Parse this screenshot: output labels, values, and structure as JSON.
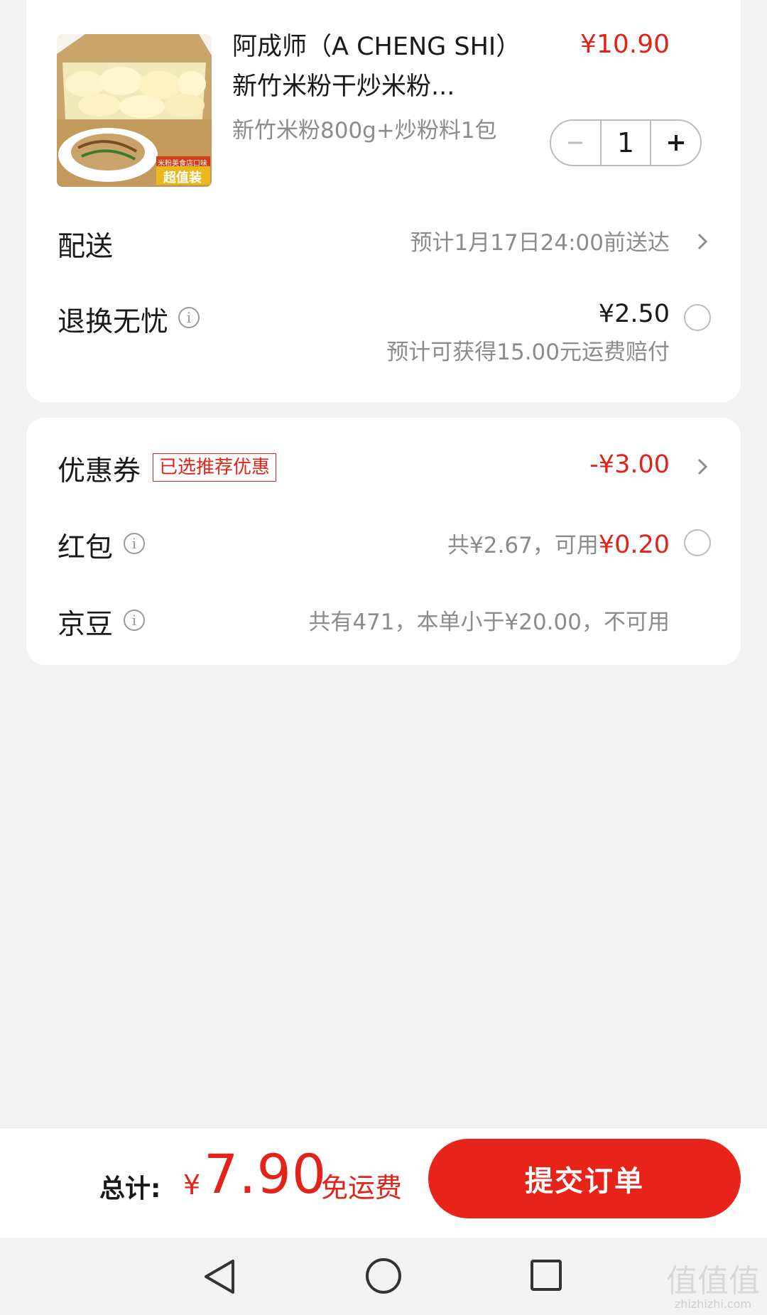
{
  "product": {
    "title": "阿成师（A CHENG SHI） 新竹米粉干炒米粉...",
    "price": "¥10.90",
    "spec": "新竹米粉800g+炒粉料1包",
    "quantity": "1",
    "image_badge": "米粉美食店口味",
    "image_tag": "超值装"
  },
  "delivery": {
    "label": "配送",
    "value": "预计1月17日24:00前送达"
  },
  "return_service": {
    "label": "退换无忧",
    "price": "¥2.50",
    "note": "预计可获得15.00元运费赔付"
  },
  "coupon": {
    "label": "优惠券",
    "badge": "已选推荐优惠",
    "value": "-¥3.00"
  },
  "red_packet": {
    "label": "红包",
    "value_prefix": "共¥2.67，可用",
    "value_amount": "¥0.20"
  },
  "jingdou": {
    "label": "京豆",
    "value": "共有471，本单小于¥20.00，不可用"
  },
  "footer": {
    "total_label": "总计:",
    "currency": "¥",
    "total_amount": "7.90",
    "free_shipping": "免运费",
    "submit_label": "提交订单"
  },
  "watermark": {
    "main": "值值值",
    "sub": "zhizhizhi.com"
  },
  "colors": {
    "accent": "#e2231a",
    "background": "#f2f2f2",
    "muted_text": "#8c8c8c"
  },
  "icons": [
    "minus-icon",
    "plus-icon",
    "chevron-right-icon",
    "info-icon",
    "radio-empty-icon",
    "nav-back-icon",
    "nav-home-icon",
    "nav-recent-icon"
  ]
}
